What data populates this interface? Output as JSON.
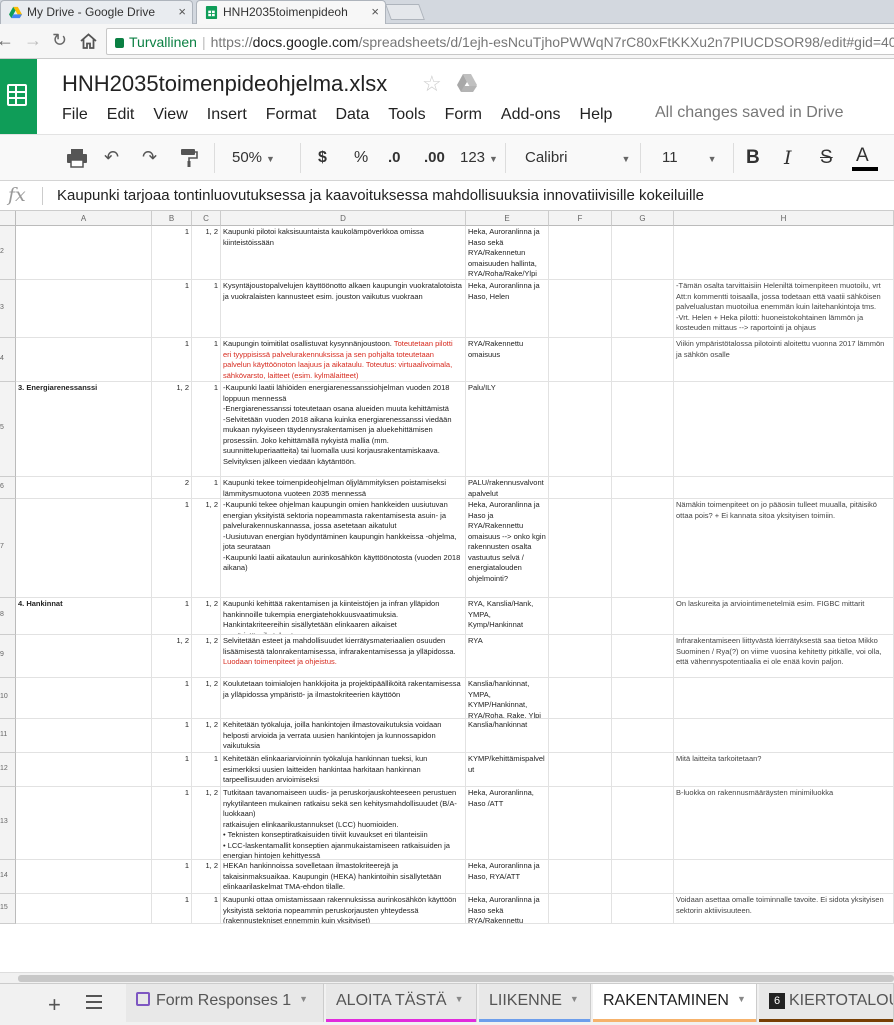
{
  "browser": {
    "tabs": [
      {
        "title": "My Drive - Google Drive",
        "close": "×"
      },
      {
        "title": "HNH2035toimenpideoh",
        "close": "×"
      }
    ],
    "secure_label": "Turvallinen",
    "url_scheme": "https://",
    "url_domain": "docs.google.com",
    "url_rest": "/spreadsheets/d/1ejh-esNcuTjhoPWWqN7rC80xFtKKXu2n7PIUCDSOR98/edit#gid=40"
  },
  "doc": {
    "title": "HNH2035toimenpideohjelma.xlsx",
    "menus": [
      "File",
      "Edit",
      "View",
      "Insert",
      "Format",
      "Data",
      "Tools",
      "Form",
      "Add-ons",
      "Help"
    ],
    "save_status": "All changes saved in Drive"
  },
  "toolbar": {
    "zoom": "50%",
    "currency": "$",
    "percent": "%",
    "dec_less": ".0",
    "dec_more": ".00",
    "number_format": "123",
    "font": "Calibri",
    "font_size": "11",
    "bold": "B",
    "italic": "I",
    "strike": "S",
    "text_color": "A"
  },
  "formula_bar": {
    "fx": "fx",
    "content": "Kaupunki tarjoaa tontinluovutuksessa ja kaavoituksessa mahdollisuuksia innovatiivisille kokeiluille"
  },
  "columns": [
    "A",
    "B",
    "C",
    "D",
    "E",
    "F",
    "G",
    "H"
  ],
  "rows": [
    {
      "n": "2",
      "a": "",
      "b": "1",
      "c": "1, 2",
      "d": "Kaupunki pilotoi kaksisuuntaista kaukolämpöverkkoa omissa kiinteistöissään",
      "d_red": "",
      "e": "Heka, Auroranlinna ja Haso sekä RYA/Rakennetun omaisuuden hallinta, RYA/Roha/Rake/Ylpi",
      "h": ""
    },
    {
      "n": "3",
      "a": "",
      "b": "1",
      "c": "1",
      "d": "Kysyntäjoustopalvelujen käyttöönotto alkaen kaupungin vuokratalotoista ja vuokralaisten kannusteet esim. jouston vaikutus vuokraan",
      "d_red": "",
      "e": "Heka, Auroranlinna ja Haso, Helen",
      "h": "-Tämän osalta tarvittaisiin Heleniltä toimenpiteen muotoilu, vrt Att:n kommentti toisaalla, jossa todetaan että vaatii sähköisen palvelualustan muotoilua enemmän kuin laitehankintoja tms.\n-Vrt. Helen + Heka pilotti: huoneistokohtainen lämmön ja kosteuden mittaus --> raportointi ja ohjaus"
    },
    {
      "n": "4",
      "a": "",
      "b": "1",
      "c": "1",
      "d": "Kaupungin toimitilat osallistuvat kysynnänjoustoon. ",
      "d_red": "Toteutetaan pilotti eri tyyppisissä palvelurakennuksissa ja sen pohjalta toteutetaan palvelun käyttöönoton laajuus ja aikataulu. Toteutus: virtuaalivoimala, sähkövarsto, laitteet (esim. kylmälaitteet)",
      "e": "RYA/Rakennettu omaisuus",
      "h": "Viikin ympäristötalossa pilotointi aloitettu vuonna 2017 lämmön ja sähkön osalle"
    },
    {
      "n": "5",
      "a": "3. Energiarenessanssi",
      "b": "1, 2",
      "c": "1",
      "d": "-Kaupunki laatii lähiöiden energiarenessanssiohjelman vuoden 2018 loppuun mennessä\n -Energiarenessanssi toteutetaan osana alueiden muuta kehittämistä\n -Selvitetään vuoden 2018 aikana kuinka energiarenessanssi viedään mukaan nykyiseen täydennysrakentamisen ja aluekehittämisen prosessiin. Joko kehittämällä nykyistä mallia (mm. suunnitteluperiaatteita) tai luomalla uusi korjausrakentamiskaava. Selvityksen jälkeen viedään käytäntöön.",
      "d_red": "",
      "e": "Palu/ILY",
      "h": ""
    },
    {
      "n": "6",
      "a": "",
      "b": "2",
      "c": "1",
      "d": "Kaupunki tekee toimenpideohjelman öljylämmityksen poistamiseksi lämmitysmuotona vuoteen 2035 mennessä",
      "d_red": "",
      "e": "PALU/rakennusvalvontapalvelut",
      "h": ""
    },
    {
      "n": "7",
      "a": "",
      "b": "1",
      "c": "1, 2",
      "d": "-Kaupunki tekee ohjelman kaupungin omien hankkeiden uusiutuvan energian yksityistä sektoria nopeammasta rakentamisesta asuin- ja palvelurakennuskannassa, jossa asetetaan aikatulut\n -Uusiutuvan energian hyödyntäminen kaupungin hankkeissa -ohjelma, jota seurataan\n -Kaupunki laatii aikataulun aurinkosähkön käyttöönotosta (vuoden 2018 aikana)",
      "d_red": "",
      "e": "Heka, Auroranlinna ja Haso ja RYA/Rakennettu omaisuus --> onko kgin rakennusten osalta vastuutus selvä / energiatalouden ohjelmointi?",
      "h": "Nämäkin toimenpiteet on jo pääosin tulleet muualla, pitäisikö ottaa pois? + Ei kannata sitoa yksityisen toimiin."
    },
    {
      "n": "8",
      "a": "4. Hankinnat",
      "b": "1",
      "c": "1, 2",
      "d": "Kaupunki kehittää rakentamisen ja kiinteistöjen ja infran ylläpidon hankinnoille tukempia energiatehokkuusvaatimuksia. Hankintakriteereihin sisällytetään elinkaaren aikaiset ympäristövaikutukset.",
      "d_red": "",
      "e": "RYA, Kanslia/Hank, YMPA, Kymp/Hankinnat",
      "h": "On laskureita ja arviointimenetelmiä esim. FIGBC mittarit"
    },
    {
      "n": "9",
      "a": "",
      "b": "1, 2",
      "c": "1, 2",
      "d": "Selvitetään esteet ja mahdollisuudet kierrätysmateriaalien osuuden lisäämisestä talonrakentamisessa, infrarakentamisessa ja ylläpidossa. ",
      "d_red": "Luodaan toimenpiteet ja ohjeistus.",
      "e": "RYA",
      "h": "Infrarakentamiseen liittyvästä kierrätyksestä saa tietoa Mikko Suominen / Rya(?) on viime vuosina kehitetty pitkälle, voi olla, että vähennyspotentiaalia ei ole enää kovin paljon."
    },
    {
      "n": "10",
      "a": "",
      "b": "1",
      "c": "1, 2",
      "d": "Koulutetaan toimialojen hankkijoita ja projektipäälliköitä rakentamisessa ja ylläpidossa ympäristö- ja ilmastokriteerien käyttöön",
      "d_red": "",
      "e": "Kanslia/hankinnat, YMPA, KYMP/Hankinnat, RYA/Roha, Rake, Ylpi",
      "h": ""
    },
    {
      "n": "11",
      "a": "",
      "b": "1",
      "c": "1, 2",
      "d": "Kehitetään työkaluja, joilla hankintojen ilmastovaikutuksia voidaan helposti arvioida ja verrata uusien hankintojen ja kunnossapidon vaikutuksia",
      "d_red": "",
      "e": "Kanslia/hankinnat",
      "h": ""
    },
    {
      "n": "12",
      "a": "",
      "b": "1",
      "c": "1",
      "d": "Kehitetään elinkaariarvioinnin työkaluja hankinnan tueksi, kun esimerkiksi uusien laitteiden hankintaa harkitaan hankinnan tarpeellisuuden arvioimiseksi",
      "d_red": "",
      "e": "KYMP/kehittämispalvelut",
      "h": "Mitä laitteita tarkoitetaan?"
    },
    {
      "n": "13",
      "a": "",
      "b": "1",
      "c": "1, 2",
      "d": "Tutkitaan tavanomaiseen uudis- ja peruskorjauskohteeseen perustuen\n nykytilanteen mukainen ratkaisu sekä sen kehitysmahdollisuudet (B/A-luokkaan)\n ratkaisujen elinkaarikustannukset (LCC) huomioiden.\n • Teknisten konseptiratkaisuiden tiiviit kuvaukset eri tilanteisiin\n • LCC-laskentamallit konseptien ajanmukaistamiseen ratkaisuiden ja\n energian hintojen kehittyessä\n • Tarkastusmalli ATT:n konseptin mukaisen suunnitelman varmentamiseen hankkeen eri vaiheissa.",
      "d_red": "",
      "e": "Heka, Auroranlinna, Haso /ATT",
      "h": "B-luokka on rakennusmääräysten minimiluokka"
    },
    {
      "n": "14",
      "a": "",
      "b": "1",
      "c": "1, 2",
      "d": "HEKAn hankinnoissa sovelletaan ilmastokriteerejä ja takaisinmaksuaikaa. Kaupungin (HEKA) hankintoihin sisällytetään elinkaarilaskelmat TMA-ehdon tilalle.",
      "d_red": "",
      "e": "Heka, Auroranlinna ja Haso, RYA/ATT",
      "h": ""
    },
    {
      "n": "15",
      "a": "",
      "b": "1",
      "c": "1",
      "d": "Kaupunki ottaa omistamissaan rakennuksissa aurinkosähkön käyttöön yksityistä sektoria nopeammin peruskorjausten yhteydessä (rakennustekniset ennemmin kuin yksityiset)",
      "d_red": "",
      "e": "Heka, Auroranlinna ja Haso sekä RYA/Rakennettu",
      "h": "Voidaan asettaa omalle toiminnalle tavoite. Ei sidota yksityisen sektorin aktiivisuuteen."
    }
  ],
  "sheet_tabs": [
    {
      "label": "Form Responses 1",
      "color": ""
    },
    {
      "label": "ALOITA TÄSTÄ",
      "color": "#e12bdc"
    },
    {
      "label": "LIIKENNE",
      "color": "#6d9eeb"
    },
    {
      "label": "RAKENTAMINEN",
      "color": "#f6b26b"
    },
    {
      "label": "KIERTOTALOU",
      "badge": "6",
      "color": "#783f04"
    }
  ]
}
